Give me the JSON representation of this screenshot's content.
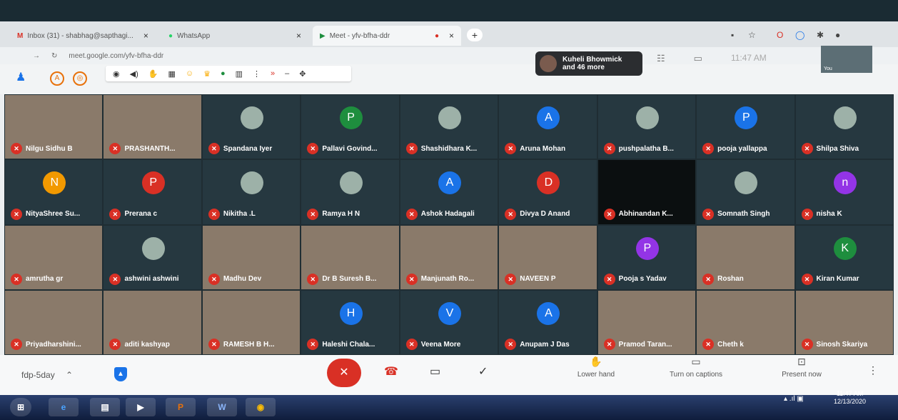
{
  "browser": {
    "tabs": [
      {
        "title": "Inbox (31) - shabhag@sapthagi..."
      },
      {
        "title": "WhatsApp"
      },
      {
        "title": "Meet - yfv-bfha-ddr"
      }
    ],
    "url": "meet.google.com/yfv-bfha-ddr"
  },
  "meet": {
    "presenter_name": "Kuheli Bhowmick",
    "presenter_more": "and 46 more",
    "time": "11:47 AM",
    "self_label": "You",
    "meeting_code": "fdp-5day",
    "participants": [
      {
        "name": "Nilgu Sidhu B",
        "type": "photo"
      },
      {
        "name": "PRASHANTH...",
        "type": "photo"
      },
      {
        "name": "Spandana Iyer",
        "type": "img"
      },
      {
        "name": "Pallavi Govind...",
        "type": "letter",
        "letter": "P",
        "color": "#1e8e3e"
      },
      {
        "name": "Shashidhara K...",
        "type": "img"
      },
      {
        "name": "Aruna Mohan",
        "type": "letter",
        "letter": "A",
        "color": "#1a73e8"
      },
      {
        "name": "pushpalatha B...",
        "type": "img"
      },
      {
        "name": "pooja yallappa",
        "type": "letter",
        "letter": "P",
        "color": "#1a73e8"
      },
      {
        "name": "Shilpa Shiva",
        "type": "img"
      },
      {
        "name": "NityaShree Su...",
        "type": "letter",
        "letter": "N",
        "color": "#f29900"
      },
      {
        "name": "Prerana c",
        "type": "letter",
        "letter": "P",
        "color": "#d93025"
      },
      {
        "name": "Nikitha .L",
        "type": "img"
      },
      {
        "name": "Ramya H N",
        "type": "img"
      },
      {
        "name": "Ashok Hadagali",
        "type": "letter",
        "letter": "A",
        "color": "#1a73e8"
      },
      {
        "name": "Divya D Anand",
        "type": "letter",
        "letter": "D",
        "color": "#d93025"
      },
      {
        "name": "Abhinandan K...",
        "type": "dark"
      },
      {
        "name": "Somnath Singh",
        "type": "img"
      },
      {
        "name": "nisha K",
        "type": "letter",
        "letter": "n",
        "color": "#9334e6"
      },
      {
        "name": "amrutha gr",
        "type": "photo"
      },
      {
        "name": "ashwini ashwini",
        "type": "img"
      },
      {
        "name": "Madhu Dev",
        "type": "photo"
      },
      {
        "name": "Dr B Suresh B...",
        "type": "photo"
      },
      {
        "name": "Manjunath Ro...",
        "type": "photo"
      },
      {
        "name": "NAVEEN P",
        "type": "photo"
      },
      {
        "name": "Pooja s Yadav",
        "type": "letter",
        "letter": "P",
        "color": "#9334e6"
      },
      {
        "name": "Roshan",
        "type": "photo"
      },
      {
        "name": "Kiran Kumar",
        "type": "letter",
        "letter": "K",
        "color": "#1e8e3e"
      },
      {
        "name": "Priyadharshini...",
        "type": "photo"
      },
      {
        "name": "aditi kashyap",
        "type": "photo"
      },
      {
        "name": "RAMESH B H...",
        "type": "photo"
      },
      {
        "name": "Haleshi Chala...",
        "type": "letter",
        "letter": "H",
        "color": "#1a73e8"
      },
      {
        "name": "Veena More",
        "type": "letter",
        "letter": "V",
        "color": "#1a73e8"
      },
      {
        "name": "Anupam J Das",
        "type": "letter",
        "letter": "A",
        "color": "#1a73e8"
      },
      {
        "name": "Pramod Taran...",
        "type": "photo"
      },
      {
        "name": "Cheth k",
        "type": "photo"
      },
      {
        "name": "Sinosh Skariya",
        "type": "photo"
      }
    ],
    "actions": {
      "lower_hand": "Lower hand",
      "captions": "Turn on captions",
      "present": "Present now"
    }
  },
  "taskbar": {
    "clock_time": "11:47 AM",
    "clock_date": "12/13/2020"
  }
}
